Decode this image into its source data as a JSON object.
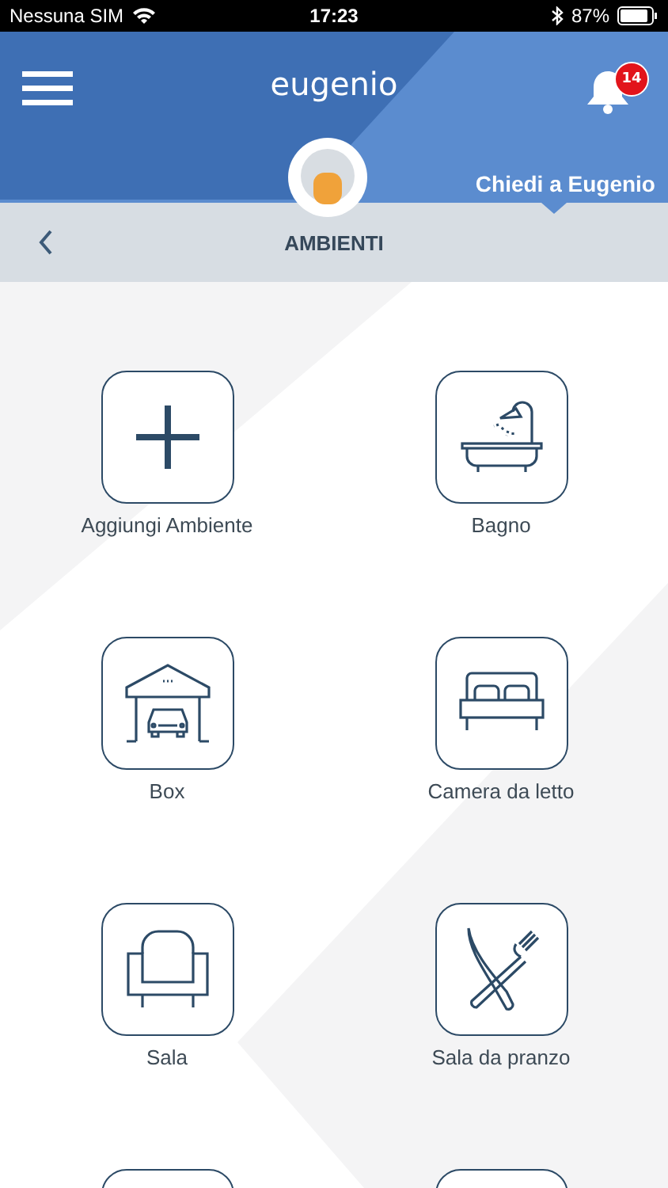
{
  "status_bar": {
    "carrier": "Nessuna SIM",
    "time": "17:23",
    "battery": "87%"
  },
  "header": {
    "logo": "eugenio",
    "badge": "14",
    "assistant_link": "Chiedi a Eugenio"
  },
  "nav": {
    "title": "AMBIENTI"
  },
  "rooms": [
    {
      "kind": "add",
      "label": "Aggiungi Ambiente"
    },
    {
      "kind": "bath",
      "label": "Bagno"
    },
    {
      "kind": "garage",
      "label": "Box"
    },
    {
      "kind": "bed",
      "label": "Camera da letto"
    },
    {
      "kind": "armchair",
      "label": "Sala"
    },
    {
      "kind": "dining",
      "label": "Sala da pranzo"
    },
    {
      "kind": "cut"
    },
    {
      "kind": "cut"
    }
  ]
}
